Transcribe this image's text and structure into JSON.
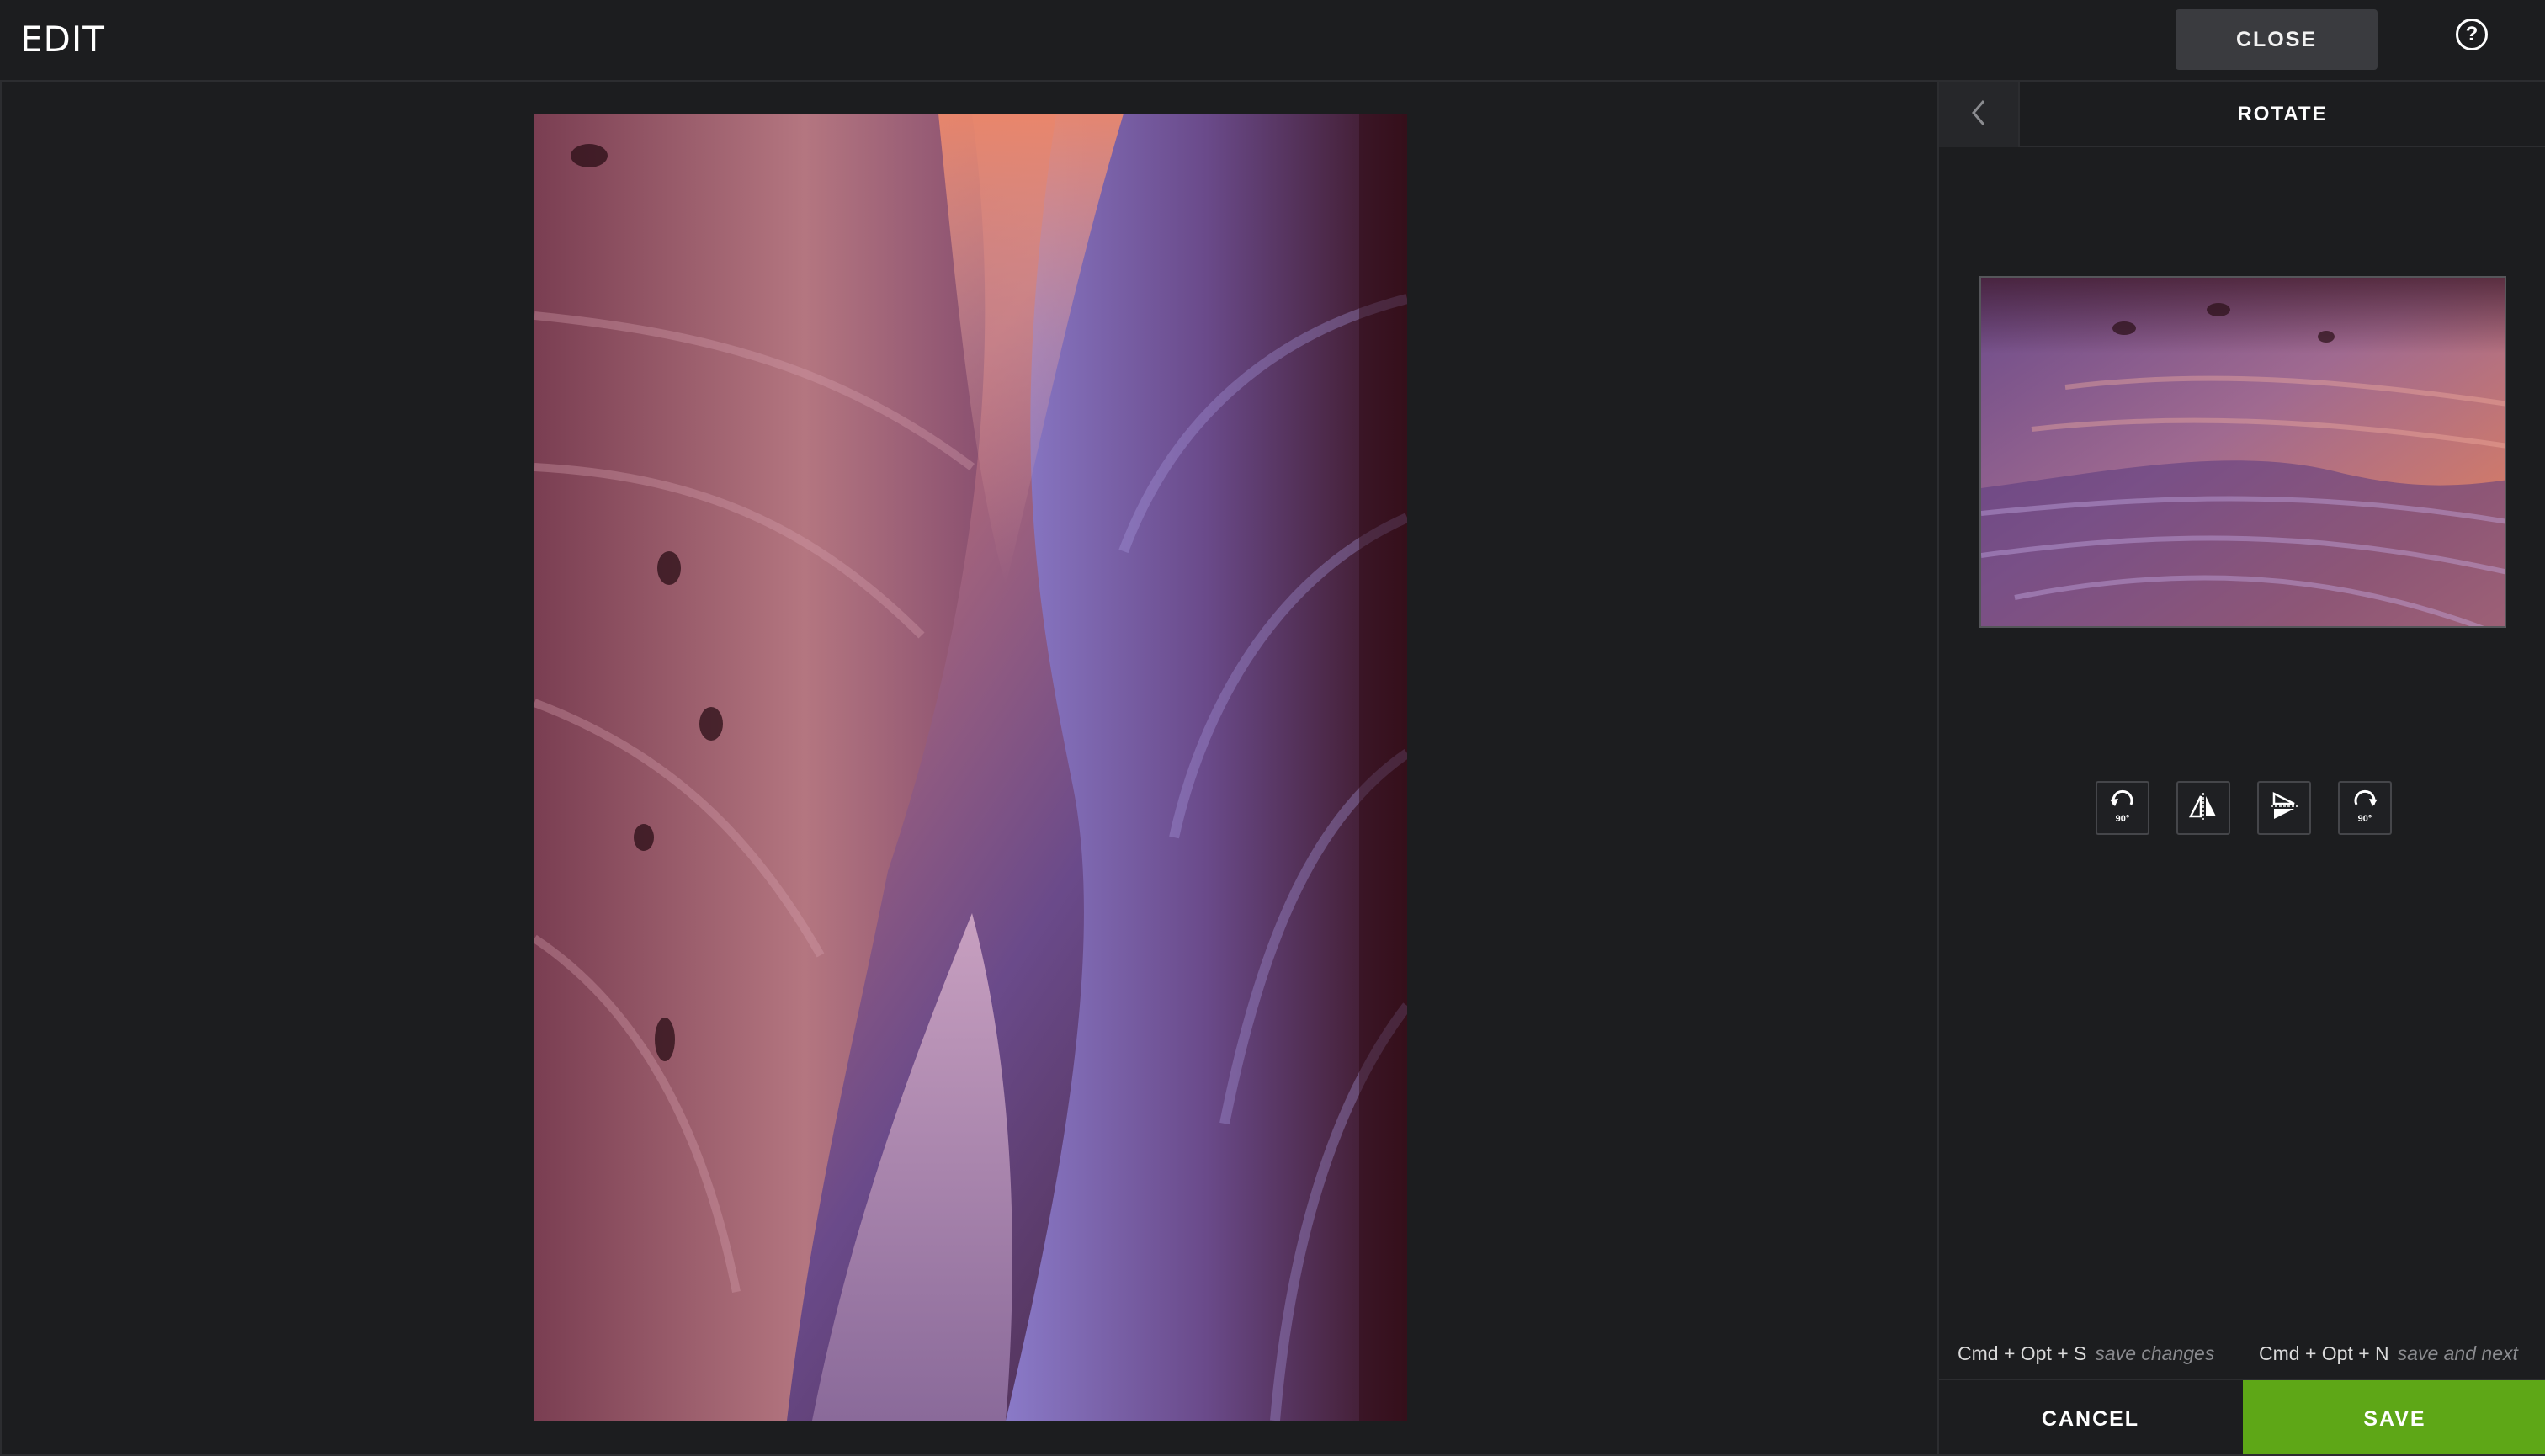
{
  "header": {
    "title": "EDIT",
    "close_label": "CLOSE",
    "help_icon": "question-circle-icon"
  },
  "panel": {
    "back_icon": "chevron-left-icon",
    "title": "ROTATE",
    "tools": [
      {
        "name": "rotate-left-90-icon",
        "label": "90°"
      },
      {
        "name": "flip-horizontal-icon",
        "label": ""
      },
      {
        "name": "flip-vertical-icon",
        "label": ""
      },
      {
        "name": "rotate-right-90-icon",
        "label": "90°"
      }
    ],
    "shortcuts": [
      {
        "keys": "Cmd + Opt + S",
        "desc": "save changes"
      },
      {
        "keys": "Cmd + Opt + N",
        "desc": "save and next"
      }
    ],
    "cancel_label": "CANCEL",
    "save_label": "SAVE"
  },
  "colors": {
    "background": "#1c1d1f",
    "save_accent": "#5ea717",
    "close_button": "#3a3b3f"
  }
}
